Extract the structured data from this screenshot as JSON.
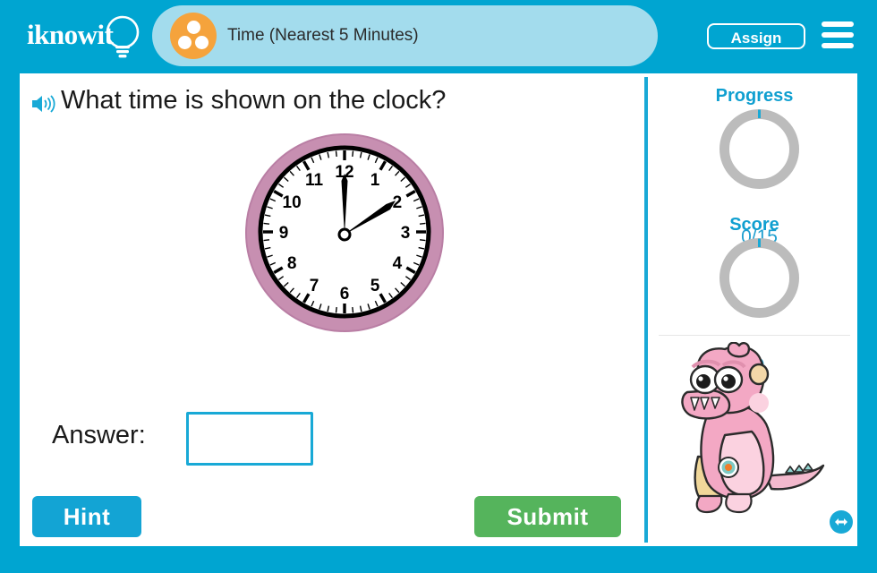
{
  "header": {
    "logo_text": "iknowit",
    "logo_icon": "lightbulb-icon",
    "subject_icon": "three-dots-circle-icon",
    "title": "Time (Nearest 5 Minutes)",
    "assign_label": "Assign",
    "menu_icon": "hamburger-menu-icon",
    "bar_color": "#00a5d1",
    "tab_color": "#a3dced",
    "subject_icon_color": "#f5a33c"
  },
  "main": {
    "speaker_icon": "speaker-sound-icon",
    "question": "What time is shown on the clock?",
    "clock": {
      "icon": "analog-clock",
      "hour_hand_value": 12,
      "minute_hand_value": 2,
      "minutes": 10,
      "time_shown": "12:10",
      "numbers": [
        "12",
        "1",
        "2",
        "3",
        "4",
        "5",
        "6",
        "7",
        "8",
        "9",
        "10",
        "11"
      ],
      "bezel_color": "#c289ac",
      "face_color": "#ffffff",
      "hand_color": "#000000"
    },
    "answer_label": "Answer:",
    "answer_value": "",
    "answer_placeholder": "",
    "hint_label": "Hint",
    "submit_label": "Submit",
    "hint_color": "#13a4d4",
    "submit_color": "#55b45c",
    "input_border_color": "#18a9d6"
  },
  "rail": {
    "progress_label": "Progress",
    "progress_value": "0/15",
    "score_label": "Score",
    "score_value": "0",
    "ring_color": "#bcbcbc",
    "ring_tick_color": "#18a9d6",
    "accent_color": "#0f9fd0",
    "mascot_icon": "pink-monster-mascot",
    "resize_icon": "horizontal-resize-arrow-icon"
  }
}
